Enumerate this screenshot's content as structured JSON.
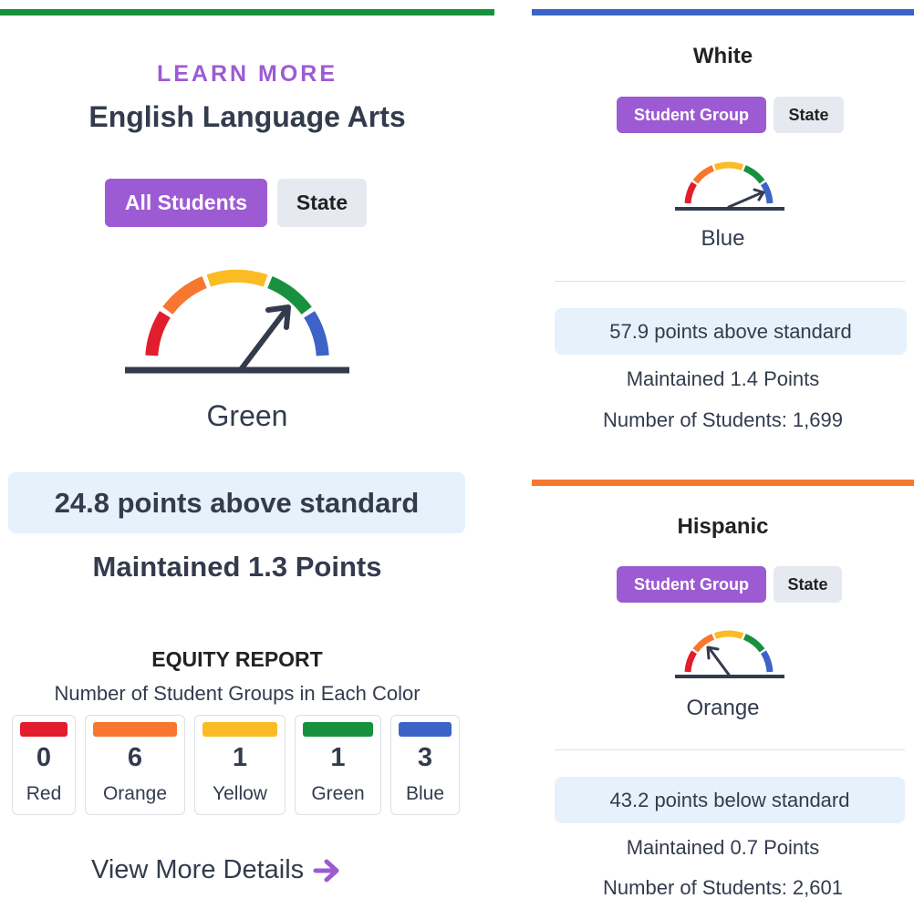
{
  "main": {
    "learn_more": "LEARN MORE",
    "title": "English Language Arts",
    "buttons": {
      "primary": "All Students",
      "secondary": "State"
    },
    "gauge": {
      "level": "Green",
      "active_segment": 4
    },
    "status_text": "24.8 points above standard",
    "change_text": "Maintained 1.3 Points",
    "equity": {
      "title": "EQUITY REPORT",
      "subtitle": "Number of Student Groups in Each Color",
      "colors": [
        {
          "name": "Red",
          "count": "0",
          "color": "#e11d2e"
        },
        {
          "name": "Orange",
          "count": "6",
          "color": "#f7772e"
        },
        {
          "name": "Yellow",
          "count": "1",
          "color": "#fbbb24"
        },
        {
          "name": "Green",
          "count": "1",
          "color": "#17913d"
        },
        {
          "name": "Blue",
          "count": "3",
          "color": "#3c63c8"
        }
      ]
    },
    "details_link": "View More Details",
    "accent_color": "#17913d"
  },
  "groups": [
    {
      "name": "White",
      "buttons": {
        "primary": "Student Group",
        "secondary": "State"
      },
      "gauge": {
        "level": "Blue",
        "active_segment": 5
      },
      "status_text": "57.9 points above standard",
      "change_text": "Maintained 1.4 Points",
      "students_text": "Number of Students: 1,699",
      "accent_color": "#3c63c8"
    },
    {
      "name": "Hispanic",
      "buttons": {
        "primary": "Student Group",
        "secondary": "State"
      },
      "gauge": {
        "level": "Orange",
        "active_segment": 2
      },
      "status_text": "43.2 points below standard",
      "change_text": "Maintained 0.7 Points",
      "students_text": "Number of Students: 2,601",
      "accent_color": "#f7772e"
    }
  ],
  "colors": {
    "purple": "#9c5bd2",
    "dark": "#333b4d",
    "light_blue_box": "#e6f1fb"
  },
  "icons": {
    "arrow": "arrow-right-icon",
    "gauge": "gauge-icon"
  }
}
